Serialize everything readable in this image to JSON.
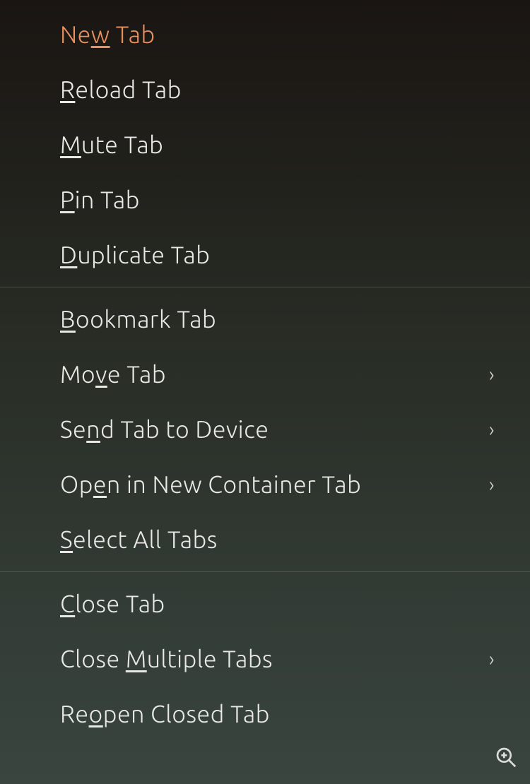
{
  "menu": {
    "groups": [
      {
        "items": [
          {
            "id": "new-tab",
            "pre": "Ne",
            "accel": "w",
            "post": " Tab",
            "submenu": false,
            "highlighted": true
          },
          {
            "id": "reload-tab",
            "pre": "",
            "accel": "R",
            "post": "eload Tab",
            "submenu": false,
            "highlighted": false
          },
          {
            "id": "mute-tab",
            "pre": "",
            "accel": "M",
            "post": "ute Tab",
            "submenu": false,
            "highlighted": false
          },
          {
            "id": "pin-tab",
            "pre": "",
            "accel": "P",
            "post": "in Tab",
            "submenu": false,
            "highlighted": false
          },
          {
            "id": "duplicate-tab",
            "pre": "",
            "accel": "D",
            "post": "uplicate Tab",
            "submenu": false,
            "highlighted": false
          }
        ]
      },
      {
        "items": [
          {
            "id": "bookmark-tab",
            "pre": "",
            "accel": "B",
            "post": "ookmark Tab",
            "submenu": false,
            "highlighted": false
          },
          {
            "id": "move-tab",
            "pre": "Mo",
            "accel": "v",
            "post": "e Tab",
            "submenu": true,
            "highlighted": false
          },
          {
            "id": "send-tab-to-device",
            "pre": "Se",
            "accel": "n",
            "post": "d Tab to Device",
            "submenu": true,
            "highlighted": false
          },
          {
            "id": "open-in-new-container-tab",
            "pre": "Op",
            "accel": "e",
            "post": "n in New Container Tab",
            "submenu": true,
            "highlighted": false
          },
          {
            "id": "select-all-tabs",
            "pre": "",
            "accel": "S",
            "post": "elect All Tabs",
            "submenu": false,
            "highlighted": false
          }
        ]
      },
      {
        "items": [
          {
            "id": "close-tab",
            "pre": "",
            "accel": "C",
            "post": "lose Tab",
            "submenu": false,
            "highlighted": false
          },
          {
            "id": "close-multiple-tabs",
            "pre": "Close ",
            "accel": "M",
            "post": "ultiple Tabs",
            "submenu": true,
            "highlighted": false
          },
          {
            "id": "reopen-closed-tab",
            "pre": "Re",
            "accel": "o",
            "post": "pen Closed Tab",
            "submenu": false,
            "highlighted": false
          }
        ]
      }
    ]
  }
}
